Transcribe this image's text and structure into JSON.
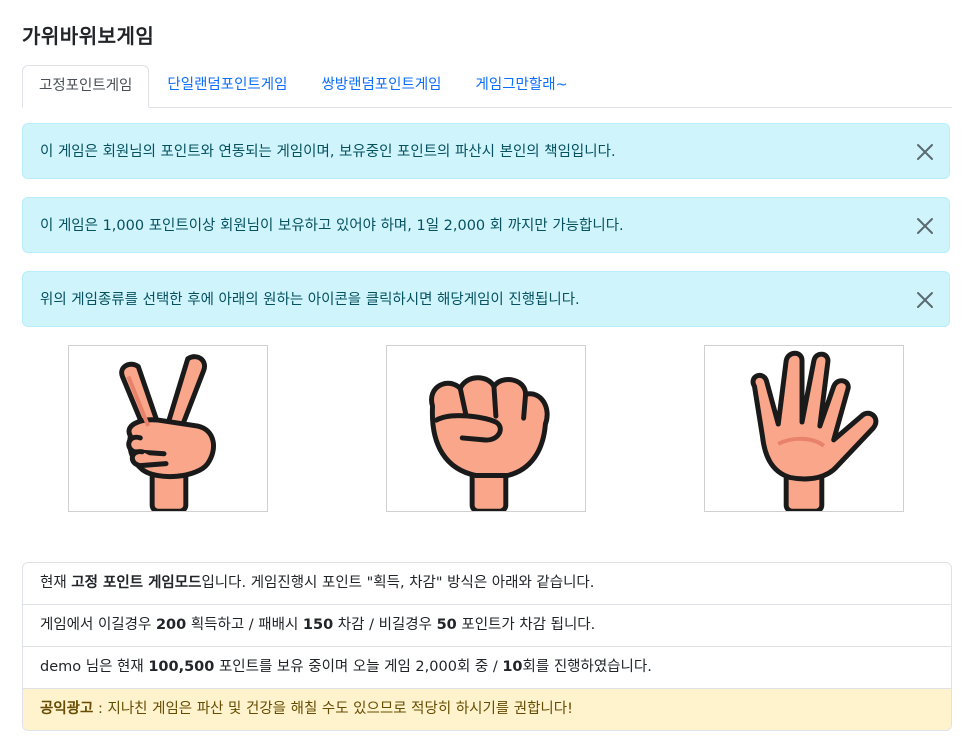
{
  "page": {
    "title": "가위바위보게임"
  },
  "tabs": [
    {
      "label": "고정포인트게임",
      "active": true
    },
    {
      "label": "단일랜덤포인트게임",
      "active": false
    },
    {
      "label": "쌍방랜덤포인트게임",
      "active": false
    },
    {
      "label": "게임그만할래~",
      "active": false
    }
  ],
  "alerts": [
    {
      "text": "이 게임은 회원님의 포인트와 연동되는 게임이며, 보유중인 포인트의 파산시 본인의 책임입니다."
    },
    {
      "text": "이 게임은 1,000 포인트이상 회원님이 보유하고 있어야 하며, 1일 2,000 회 까지만 가능합니다."
    },
    {
      "text": "위의 게임종류를 선택한 후에 아래의 원하는 아이콘을 클릭하시면 해당게임이 진행됩니다."
    }
  ],
  "choices": [
    {
      "icon": "scissors-hand-icon"
    },
    {
      "icon": "rock-fist-icon"
    },
    {
      "icon": "paper-hand-icon"
    }
  ],
  "info": {
    "row1": {
      "a": "현재 ",
      "b": "고정 포인트 게임모드",
      "c": "입니다. 게임진행시 포인트 \"획득, 차감\" 방식은 아래와 같습니다."
    },
    "row2": {
      "a": "게임에서 이길경우 ",
      "b": "200",
      "c": " 획득하고 / 패배시 ",
      "d": "150",
      "e": " 차감 / 비길경우 ",
      "f": "50",
      "g": " 포인트가 차감 됩니다."
    },
    "row3": {
      "a": "demo 님은 현재 ",
      "b": "100,500",
      "c": " 포인트를 보유 중이며 오늘 게임 2,000회 중 / ",
      "d": "10",
      "e": "회를 진행하였습니다."
    },
    "ad": {
      "label": "공익광고",
      "text": " : 지나친 게임은 파산 및 건강을 해칠 수도 있으므로 적당히 하시기를 권합니다!"
    }
  },
  "colors": {
    "alert_bg": "#cff4fc",
    "alert_text": "#055160",
    "link": "#0d6efd",
    "skin": "#f9a68a",
    "skin_shade": "#e8826a",
    "ad_bg": "#fff3cd",
    "ad_text": "#664d03"
  }
}
